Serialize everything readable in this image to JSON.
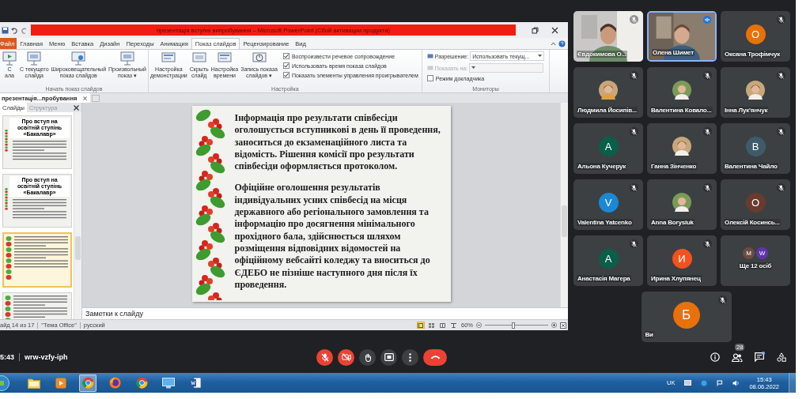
{
  "title_bar": {
    "title": "презентація вступні випробування – Microsoft PowerPoint (Сбой активации продукта)"
  },
  "ribbon_tabs": [
    {
      "label": "Файл",
      "kind": "file",
      "selected": false
    },
    {
      "label": "Главная",
      "kind": "tab",
      "selected": false
    },
    {
      "label": "Меню",
      "kind": "tab",
      "selected": false
    },
    {
      "label": "Вставка",
      "kind": "tab",
      "selected": false
    },
    {
      "label": "Дизайн",
      "kind": "tab",
      "selected": false
    },
    {
      "label": "Переходы",
      "kind": "tab",
      "selected": false
    },
    {
      "label": "Анимация",
      "kind": "tab",
      "selected": false
    },
    {
      "label": "Показ слайдов",
      "kind": "tab",
      "selected": true
    },
    {
      "label": "Рецензирование",
      "kind": "tab",
      "selected": false
    },
    {
      "label": "Вид",
      "kind": "tab",
      "selected": false
    }
  ],
  "start_group": {
    "label": "Начать показ слайдов",
    "buttons": [
      {
        "lines": [
          "С",
          "ала"
        ]
      },
      {
        "lines": [
          "С текущего",
          "слайда"
        ]
      },
      {
        "lines": [
          "Широковещательный",
          "показ слайдов"
        ]
      },
      {
        "lines": [
          "Произвольный",
          "показ ▾"
        ]
      }
    ]
  },
  "setup_group": {
    "label": "Настройка",
    "buttons": [
      {
        "lines": [
          "Настройка",
          "демонстрации"
        ]
      },
      {
        "lines": [
          "Скрыть",
          "слайд"
        ]
      },
      {
        "lines": [
          "Настройка",
          "времени"
        ]
      },
      {
        "lines": [
          "Запись показа",
          "слайдов ▾"
        ]
      }
    ],
    "checkboxes": [
      {
        "label": "Воспроизвести речевое сопровождение",
        "checked": true
      },
      {
        "label": "Использовать время показа слайдов",
        "checked": true
      },
      {
        "label": "Показать элементы управления проигрывателем",
        "checked": true
      }
    ]
  },
  "monitors_group": {
    "label": "Мониторы",
    "fields": [
      {
        "label": "Разрешение:",
        "value": "Использовать текущ...",
        "disabled": false
      },
      {
        "label": "Показать на:",
        "disabled": true
      }
    ],
    "checkbox": {
      "label": "Режим докладчика",
      "checked": false
    }
  },
  "document_tab": {
    "label": "презентація...пробування"
  },
  "pane_tabs": [
    {
      "label": "Слайды",
      "selected": true
    },
    {
      "label": "Структура",
      "selected": false
    }
  ],
  "thumbnails": [
    {
      "title": "Про вступ на освітній ступінь «Бакалавр»",
      "selected": false
    },
    {
      "title": "Про вступ на освітній ступінь «Бакалавр»",
      "selected": false
    },
    {
      "selected": true
    },
    {
      "selected": false
    }
  ],
  "slide": {
    "paragraphs": [
      "Інформація про результати співбесіди оголошується вступникові в день її проведення, заноситься до екзаменаційного листа та відомість. Рішення комісії про результати співбесіди оформляється протоколом.",
      "Офіційне оголошення результатів індивідуальних усних співбесід на місця державного або регіонального замовлення та інформацію про досягнення мінімального прохідного бала, здійснюється шляхом розміщення відповідних відомостей на офіційному вебсайті коледжу та вноситься до ЄДЕБО не пізніше наступного дня після їх проведення."
    ]
  },
  "notes": {
    "placeholder": "Заметки к слайду"
  },
  "status_bar": {
    "slide": "айд 14 из 17",
    "theme": "\"Тема Office\"",
    "language": "русский",
    "zoom": "60%",
    "level": 0.45,
    "views": [
      {
        "kind": "normal",
        "selected": true
      },
      {
        "kind": "sorter",
        "selected": false
      },
      {
        "kind": "reading",
        "selected": false
      },
      {
        "kind": "show",
        "selected": false
      }
    ]
  },
  "participants": [
    {
      "name": "Євдокимова О...",
      "kind": "video",
      "muted": true,
      "speaking": false
    },
    {
      "name": "Олена Шимет",
      "kind": "video",
      "muted": false,
      "speaking": true
    },
    {
      "name": "Оксана Трофімчук",
      "kind": "avatar",
      "initial": "О",
      "color": "#e8710a",
      "muted": true,
      "speaking": false
    },
    {
      "name": "Людмила Йосипів...",
      "muted": true,
      "speaking": false
    },
    {
      "name": "Валентина Ковало...",
      "muted": true,
      "speaking": false
    },
    {
      "name": "Інна Лук'янчук",
      "muted": true,
      "speaking": false
    },
    {
      "name": "Альона Кучерук",
      "kind": "avatar",
      "initial": "А",
      "color": "#0b5e4a",
      "muted": true,
      "speaking": false
    },
    {
      "name": "Ганна Зінченко",
      "muted": true,
      "speaking": false
    },
    {
      "name": "Валентина Чайло",
      "kind": "avatar",
      "initial": "В",
      "color": "#3f5b6b",
      "muted": true,
      "speaking": false
    },
    {
      "name": "Valentina Yatcenko",
      "kind": "avatar",
      "initial": "V",
      "color": "#1a88d6",
      "muted": true,
      "speaking": false
    },
    {
      "name": "Anna Borysiuk",
      "muted": true,
      "speaking": false
    },
    {
      "name": "Олексій Косинсь...",
      "kind": "avatar",
      "initial": "О",
      "color": "#6b3a2e",
      "muted": true,
      "speaking": false
    },
    {
      "name": "Анастасія Магера",
      "kind": "avatar",
      "initial": "А",
      "color": "#0b5e4a",
      "muted": true,
      "speaking": false
    },
    {
      "name": "Ирина Хлупянец",
      "kind": "avatar",
      "initial": "И",
      "color": "#f4511e",
      "muted": true,
      "speaking": false
    },
    {
      "name": "Ще 12 осіб",
      "kind": "more",
      "avatars": [
        {
          "initial": "M",
          "color": "#6d4c41"
        },
        {
          "initial": "W",
          "color": "#5e35b1"
        }
      ],
      "muted": false,
      "speaking": false
    }
  ],
  "self_tile": {
    "name": "Ви",
    "initial": "Б",
    "color": "#e8710a",
    "muted": true
  },
  "meeting_bar": {
    "time": "5:43",
    "code": "wrw-vzfy-iph",
    "controls": [
      {
        "kind": "mic",
        "on": false
      },
      {
        "kind": "camera",
        "on": false
      },
      {
        "kind": "hand"
      },
      {
        "kind": "present"
      },
      {
        "kind": "more"
      },
      {
        "kind": "hangup"
      }
    ],
    "side_buttons": [
      {
        "kind": "info"
      },
      {
        "kind": "people",
        "badge": "28"
      },
      {
        "kind": "chat",
        "dot": true
      },
      {
        "kind": "activities"
      }
    ]
  },
  "taskbar": {
    "apps": [
      {
        "kind": "folder",
        "selected": false
      },
      {
        "kind": "media",
        "selected": false
      },
      {
        "kind": "chrome",
        "selected": true
      },
      {
        "kind": "firefox",
        "selected": false
      },
      {
        "kind": "chrome",
        "selected": false
      },
      {
        "kind": "desktop",
        "selected": false
      },
      {
        "kind": "word",
        "selected": false
      }
    ],
    "language": "UK",
    "time": "15:43",
    "date": "08.06.2022"
  }
}
